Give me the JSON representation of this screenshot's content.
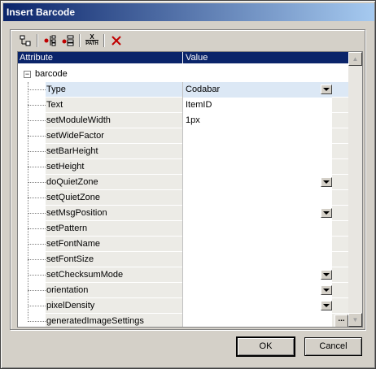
{
  "window": {
    "title": "Insert Barcode"
  },
  "toolbar": {
    "buttons": [
      {
        "name": "append-attribute-icon"
      },
      {
        "name": "insert-child-icon"
      },
      {
        "name": "insert-row-icon"
      },
      {
        "name": "xpath-icon",
        "text_top": "X",
        "text_bottom": "PATH"
      },
      {
        "name": "delete-icon"
      }
    ]
  },
  "grid": {
    "header": {
      "attribute": "Attribute",
      "value": "Value"
    },
    "root": {
      "label": "barcode",
      "expander": "−"
    },
    "rows": [
      {
        "name": "Type",
        "value": "Codabar",
        "dropdown": true,
        "selected": true
      },
      {
        "name": "Text",
        "value": "ItemID",
        "dropdown": false
      },
      {
        "name": "setModuleWidth",
        "value": "1px",
        "dropdown": false
      },
      {
        "name": "setWideFactor",
        "value": "",
        "dropdown": false
      },
      {
        "name": "setBarHeight",
        "value": "",
        "dropdown": false
      },
      {
        "name": "setHeight",
        "value": "",
        "dropdown": false
      },
      {
        "name": "doQuietZone",
        "value": "",
        "dropdown": true
      },
      {
        "name": "setQuietZone",
        "value": "",
        "dropdown": false
      },
      {
        "name": "setMsgPosition",
        "value": "",
        "dropdown": true
      },
      {
        "name": "setPattern",
        "value": "",
        "dropdown": false
      },
      {
        "name": "setFontName",
        "value": "",
        "dropdown": false
      },
      {
        "name": "setFontSize",
        "value": "",
        "dropdown": false
      },
      {
        "name": "setChecksumMode",
        "value": "",
        "dropdown": true
      },
      {
        "name": "orientation",
        "value": "",
        "dropdown": true
      },
      {
        "name": "pixelDensity",
        "value": "",
        "dropdown": true
      },
      {
        "name": "generatedImageSettings",
        "value": "",
        "dropdown": false,
        "ellipsis": "..."
      }
    ]
  },
  "footer": {
    "ok_label": "OK",
    "cancel_label": "Cancel"
  },
  "colors": {
    "title_start": "#0a246a",
    "title_end": "#a6caf0",
    "header_bg": "#0a246a",
    "selected_row": "#dce8f5"
  }
}
